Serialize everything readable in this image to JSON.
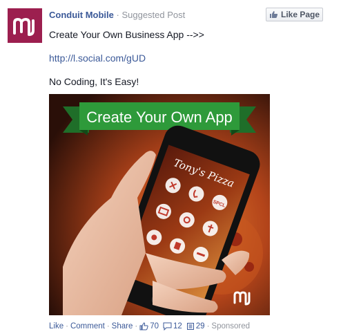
{
  "post": {
    "page_name": "Conduit Mobile",
    "separator": "·",
    "suggested_label": "Suggested Post",
    "like_page_label": "Like Page",
    "line1": "Create Your Own Business App -->>",
    "link": "http://l.social.com/gUD",
    "line3": "No Coding, It's Easy!"
  },
  "ad": {
    "banner": "Create Your Own App",
    "phone_title": "Tony's Pizza",
    "app_icon_label": "SPCL"
  },
  "footer": {
    "like": "Like",
    "comment": "Comment",
    "share": "Share",
    "likes_count": "70",
    "comments_count": "12",
    "shares_count": "29",
    "sponsored": "Sponsored"
  },
  "colors": {
    "brand": "#9c1f4f",
    "link": "#3b5998",
    "banner_green": "#2e9a3a"
  }
}
